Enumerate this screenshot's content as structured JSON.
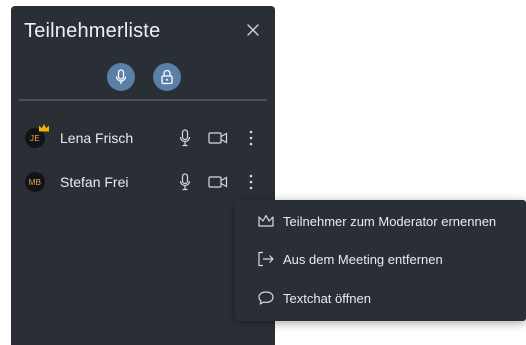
{
  "panel": {
    "title": "Teilnehmerliste",
    "close_icon": "close-icon",
    "controls": [
      {
        "icon": "microphone-icon"
      },
      {
        "icon": "lock-icon"
      }
    ]
  },
  "participants": [
    {
      "initials": "JE",
      "name": "Lena Frisch",
      "is_moderator": true,
      "icons": [
        "microphone-icon",
        "camera-icon",
        "more-vertical-icon"
      ]
    },
    {
      "initials": "MB",
      "name": "Stefan Frei",
      "is_moderator": false,
      "icons": [
        "microphone-icon",
        "camera-icon",
        "more-vertical-icon"
      ]
    }
  ],
  "context_menu": {
    "items": [
      {
        "icon": "crown-icon",
        "label": "Teilnehmer zum Moderator ernennen"
      },
      {
        "icon": "leave-icon",
        "label": "Aus dem Meeting entfernen"
      },
      {
        "icon": "chat-bubble-icon",
        "label": "Textchat öffnen"
      }
    ]
  },
  "colors": {
    "panel_bg": "#2a2f36",
    "control_button": "#5b7fa6",
    "avatar_text": "#f0a94a",
    "crown": "#f2b300"
  }
}
